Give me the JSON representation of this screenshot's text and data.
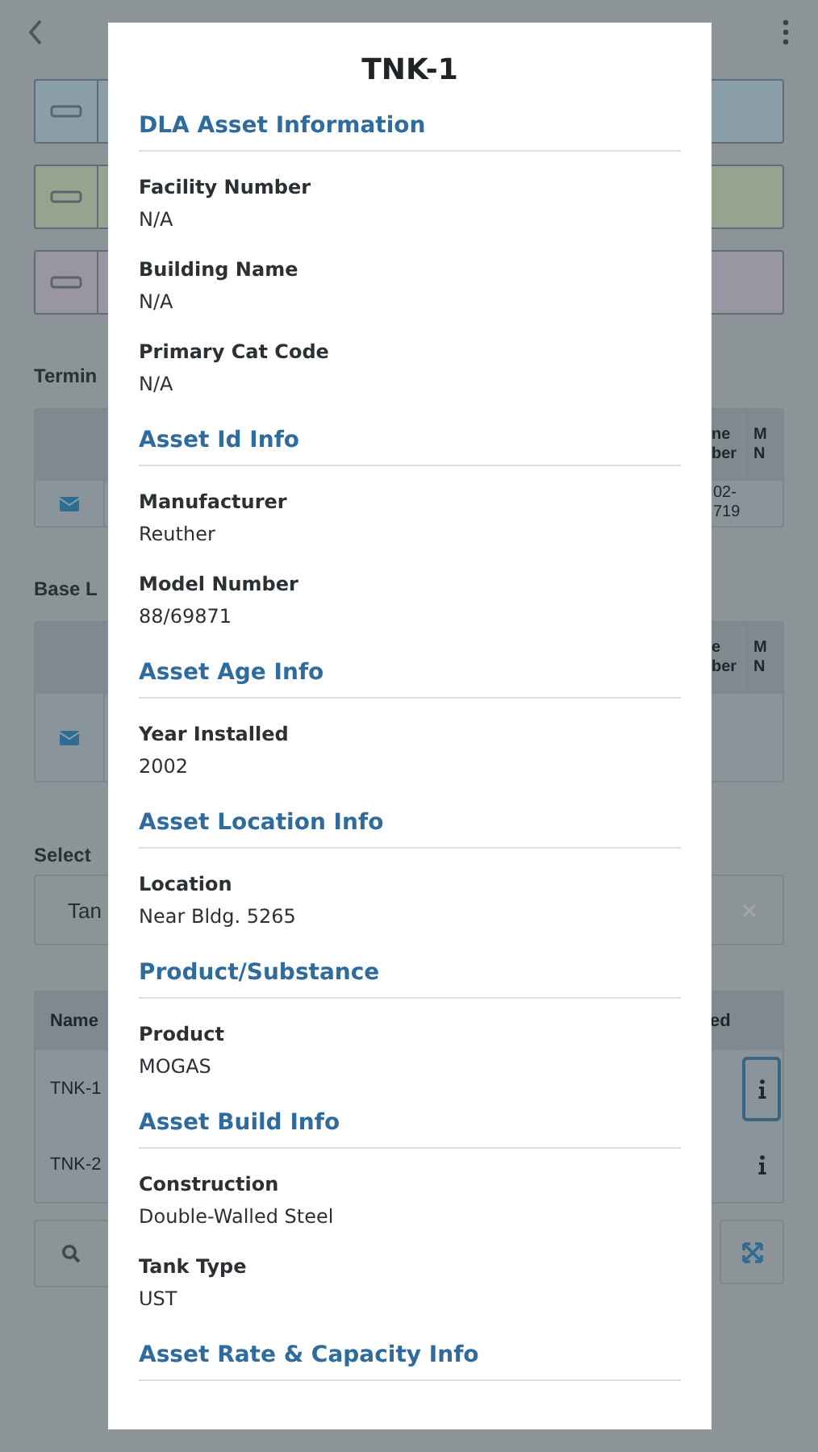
{
  "background": {
    "cards": [
      {
        "color": "#8a9eaa"
      },
      {
        "color": "#95a48f"
      },
      {
        "color": "#9a95a3"
      }
    ],
    "sections": [
      {
        "label": "Termin",
        "headers": [
          "ne\nber",
          "M\nN"
        ],
        "rows": [
          [
            "02-\n719",
            ""
          ]
        ]
      },
      {
        "label": "Base L",
        "headers": [
          "e\nber",
          "M\nN"
        ],
        "rows": [
          [
            "",
            ""
          ]
        ]
      }
    ],
    "select": {
      "label": "Select",
      "value": "Tan"
    },
    "assets": {
      "header": "Name",
      "header_end": "ed",
      "rows": [
        {
          "name": "TNK-1",
          "selected": true
        },
        {
          "name": "TNK-2",
          "selected": false
        }
      ]
    }
  },
  "modal": {
    "title": "TNK-1",
    "sections": [
      {
        "heading": "DLA Asset Information",
        "fields": [
          {
            "label": "Facility Number",
            "value": "N/A"
          },
          {
            "label": "Building Name",
            "value": "N/A"
          },
          {
            "label": "Primary Cat Code",
            "value": "N/A"
          }
        ]
      },
      {
        "heading": "Asset Id Info",
        "fields": [
          {
            "label": "Manufacturer",
            "value": "Reuther"
          },
          {
            "label": "Model Number",
            "value": "88/69871"
          }
        ]
      },
      {
        "heading": "Asset Age Info",
        "fields": [
          {
            "label": "Year Installed",
            "value": "2002"
          }
        ]
      },
      {
        "heading": "Asset Location Info",
        "fields": [
          {
            "label": "Location",
            "value": "Near Bldg. 5265"
          }
        ]
      },
      {
        "heading": "Product/Substance",
        "fields": [
          {
            "label": "Product",
            "value": "MOGAS"
          }
        ]
      },
      {
        "heading": "Asset Build Info",
        "fields": [
          {
            "label": "Construction",
            "value": "Double-Walled Steel"
          },
          {
            "label": "Tank Type",
            "value": "UST"
          }
        ]
      },
      {
        "heading": "Asset Rate & Capacity Info"
      }
    ]
  }
}
